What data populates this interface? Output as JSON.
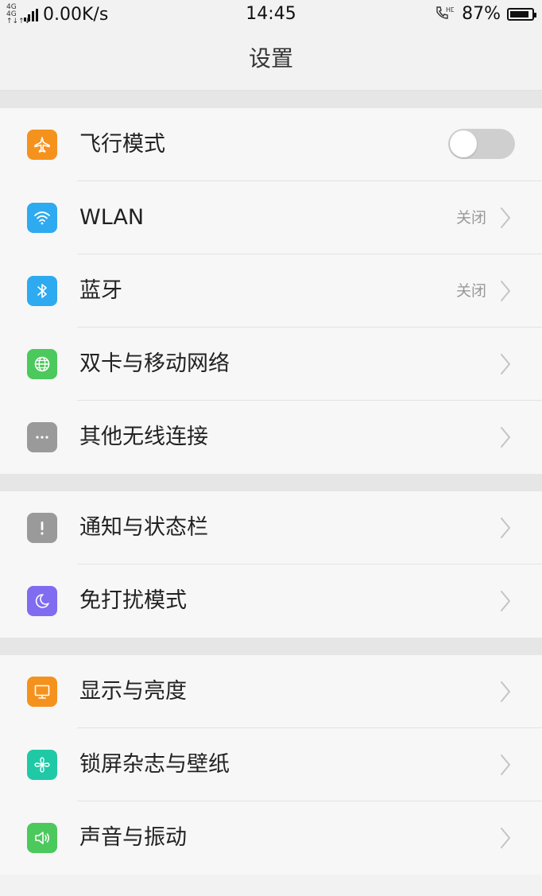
{
  "status": {
    "net_top": "4G 4G",
    "net_bottom": "↑↓↑↓",
    "speed": "0.00K/s",
    "time": "14:45",
    "hd": "HD",
    "battery": "87%",
    "battery_level": 0.87
  },
  "header": {
    "title": "设置"
  },
  "groups": [
    {
      "items": [
        {
          "label": "飞行模式",
          "icon": "airplane-icon",
          "color": "#f5921e",
          "control": "toggle",
          "toggle_on": false
        },
        {
          "label": "WLAN",
          "icon": "wifi-icon",
          "color": "#2eaaf0",
          "value": "关闭"
        },
        {
          "label": "蓝牙",
          "icon": "bluetooth-icon",
          "color": "#2eaaf0",
          "value": "关闭"
        },
        {
          "label": "双卡与移动网络",
          "icon": "globe-icon",
          "color": "#4cc95c"
        },
        {
          "label": "其他无线连接",
          "icon": "more-icon",
          "color": "#9a9a9a"
        }
      ]
    },
    {
      "items": [
        {
          "label": "通知与状态栏",
          "icon": "alert-icon",
          "color": "#9a9a9a"
        },
        {
          "label": "免打扰模式",
          "icon": "moon-icon",
          "color": "#7f6cf0"
        }
      ]
    },
    {
      "items": [
        {
          "label": "显示与亮度",
          "icon": "display-icon",
          "color": "#f5921e"
        },
        {
          "label": "锁屏杂志与壁纸",
          "icon": "pinwheel-icon",
          "color": "#1fc9a6"
        },
        {
          "label": "声音与振动",
          "icon": "speaker-icon",
          "color": "#4cc95c"
        }
      ]
    }
  ]
}
